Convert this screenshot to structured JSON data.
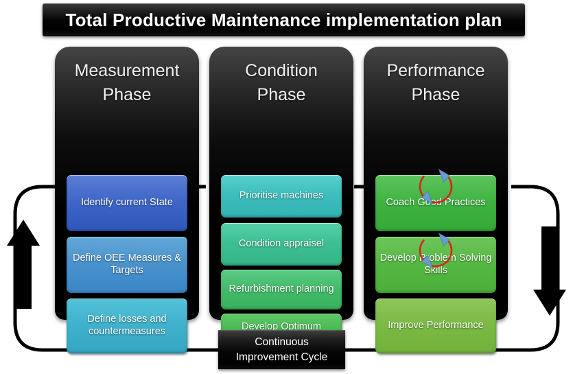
{
  "header": {
    "title": "Total Productive Maintenance implementation plan"
  },
  "phases": [
    {
      "id": "measurement",
      "title": "Measurement\nPhase",
      "title_line1": "Measurement",
      "title_line2": "Phase",
      "steps": [
        {
          "label": "Identify current State",
          "color": "#3f67c8"
        },
        {
          "label": "Define OEE Measures & Targets",
          "color": "#4b93ce"
        },
        {
          "label": "Define losses and countermeasures",
          "color": "#41b2cc"
        }
      ]
    },
    {
      "id": "condition",
      "title": "Condition\nPhase",
      "title_line1": "Condition",
      "title_line2": "Phase",
      "steps": [
        {
          "label": "Prioritise machines",
          "color": "#3dbdbd"
        },
        {
          "label": "Condition appraisel",
          "color": "#3dbf93"
        },
        {
          "label": "Refurbishment planning",
          "color": "#42bb69"
        },
        {
          "label": "Develop Optimum Maintenance plans",
          "color": "#46b850"
        }
      ]
    },
    {
      "id": "performance",
      "title": "Performance\nPhase",
      "title_line1": "Performance",
      "title_line2": "Phase",
      "steps": [
        {
          "label": "Coach Good Practices",
          "color": "#3fb342"
        },
        {
          "label": "Develop Problem Solving Skills",
          "color": "#55b842"
        },
        {
          "label": "Improve Performance",
          "color": "#7bba44"
        }
      ]
    }
  ],
  "footer": {
    "line1": "Continuous",
    "line2": "Improvement Cycle"
  },
  "cycle": {
    "left_arrow_direction": "up",
    "right_arrow_direction": "down",
    "loop_color": "#000000",
    "refresh_icon_ring_color": "#e0201b",
    "refresh_icon_head_color": "#6b9bd2"
  }
}
